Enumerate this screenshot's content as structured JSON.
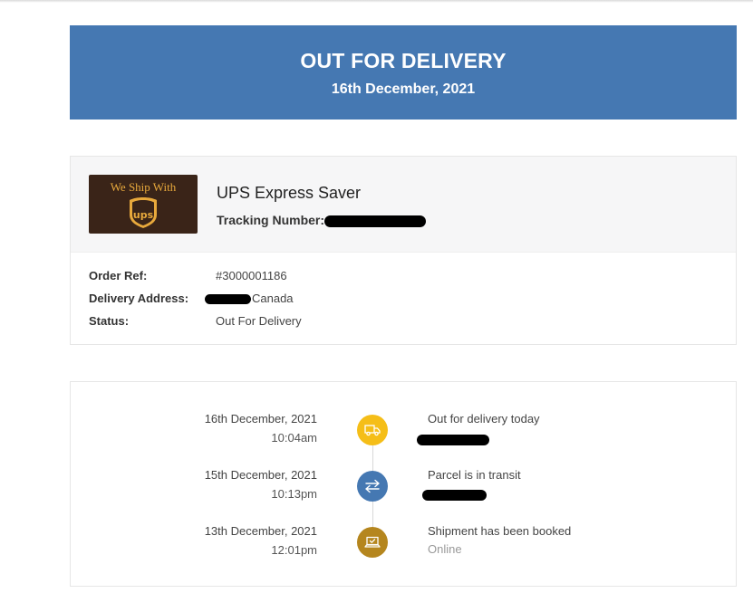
{
  "banner": {
    "title": "OUT FOR DELIVERY",
    "date": "16th December, 2021"
  },
  "shipment": {
    "logo_text": "We Ship With",
    "logo_mark": "ups",
    "carrier": "UPS Express Saver",
    "tracking_label": "Tracking Number:",
    "details": [
      {
        "label": "Order Ref:",
        "value": "#3000001186"
      },
      {
        "label": "Delivery Address:",
        "value": "Canada"
      },
      {
        "label": "Status:",
        "value": "Out For Delivery"
      }
    ]
  },
  "events": [
    {
      "date": "16th December, 2021",
      "time": "10:04am",
      "description": "Out for delivery today",
      "sub": "",
      "icon": "truck-icon",
      "color": "#f5be18"
    },
    {
      "date": "15th December, 2021",
      "time": "10:13pm",
      "description": "Parcel is in transit",
      "sub": "",
      "icon": "transfer-arrows-icon",
      "color": "#4578b2"
    },
    {
      "date": "13th December, 2021",
      "time": "12:01pm",
      "description": "Shipment has been booked",
      "sub": "Online",
      "icon": "laptop-check-icon",
      "color": "#b5861e"
    }
  ],
  "colors": {
    "banner": "#4578b2",
    "logo_bg": "#3a2418",
    "logo_accent": "#e8a93c"
  }
}
